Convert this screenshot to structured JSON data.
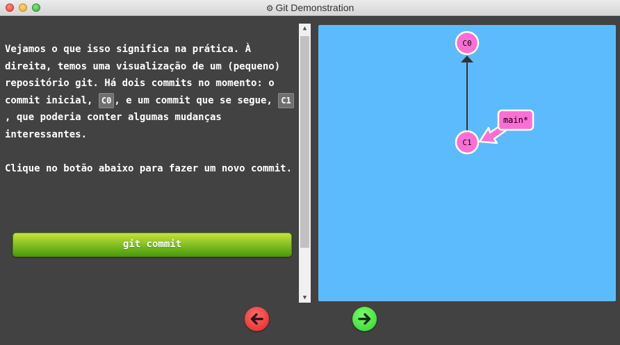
{
  "window": {
    "title": "Git Demonstration",
    "title_icon": "gear-icon"
  },
  "text_panel": {
    "para1": {
      "part1": "Vejamos o que isso significa na prática. À direita, temos uma visualização de um (pequeno) repositório git. Há dois commits no momento: o commit inicial, ",
      "code1": "C0",
      "part2": ", e um commit que se segue, ",
      "code2": "C1",
      "part3": ", que poderia conter algumas mudanças interessantes."
    },
    "para2": "Clique no botão abaixo para fazer um novo commit.",
    "button_label": "git commit"
  },
  "visualization": {
    "background_color": "#5cbbfc",
    "commits": [
      {
        "id": "C0"
      },
      {
        "id": "C1"
      }
    ],
    "branch": {
      "name": "main*",
      "points_to": "C1"
    },
    "node_color": "#ff6ed4"
  },
  "navigation": {
    "back_icon": "arrow-left-icon",
    "forward_icon": "arrow-right-icon",
    "back_color": "#e42424",
    "forward_color": "#2fd22a"
  }
}
